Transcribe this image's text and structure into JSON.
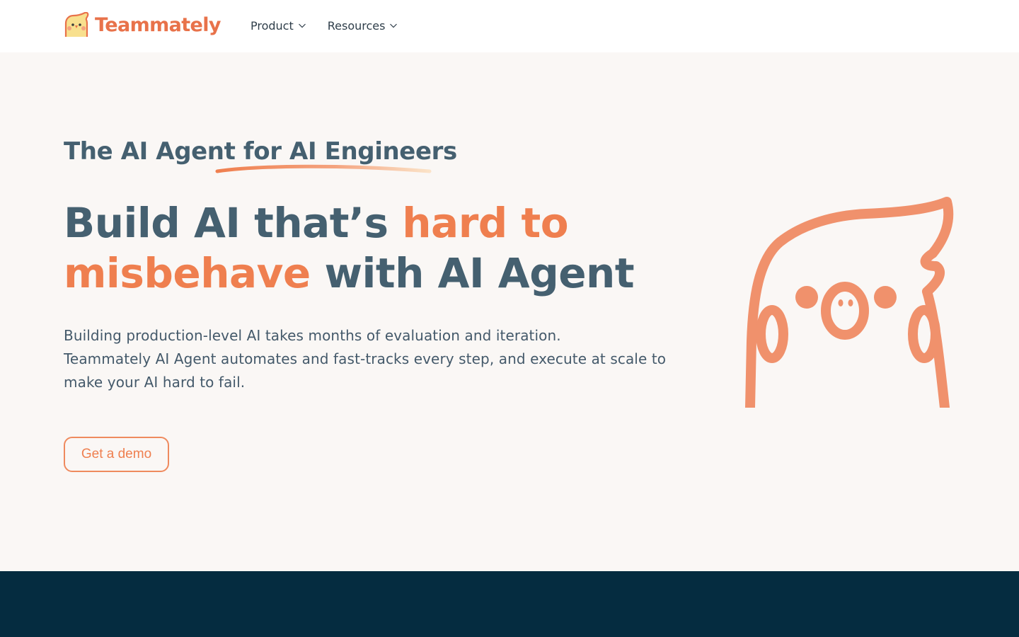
{
  "header": {
    "brand": "Teammately",
    "nav": [
      {
        "label": "Product",
        "icon": "chevron-down-icon"
      },
      {
        "label": "Resources",
        "icon": "chevron-down-icon"
      }
    ]
  },
  "hero": {
    "eyebrow": "The AI Agent for AI Engineers",
    "title_part1": "Build AI that’s ",
    "title_accent_1": "hard to",
    "title_accent_2": "misbehave",
    "title_part2": " with AI Agent",
    "description_lines": [
      "Building production-level AI takes months of evaluation and iteration.",
      "Teammately AI Agent automates and fast-tracks every step, and execute at scale to",
      "make your AI hard to fail."
    ],
    "cta_label": "Get a demo",
    "illustration": "cockatiel-mascot-icon"
  },
  "colors": {
    "accent": "#ef7f4f",
    "text": "#456070",
    "background": "#faf7f5",
    "dark_band": "#052c40"
  }
}
